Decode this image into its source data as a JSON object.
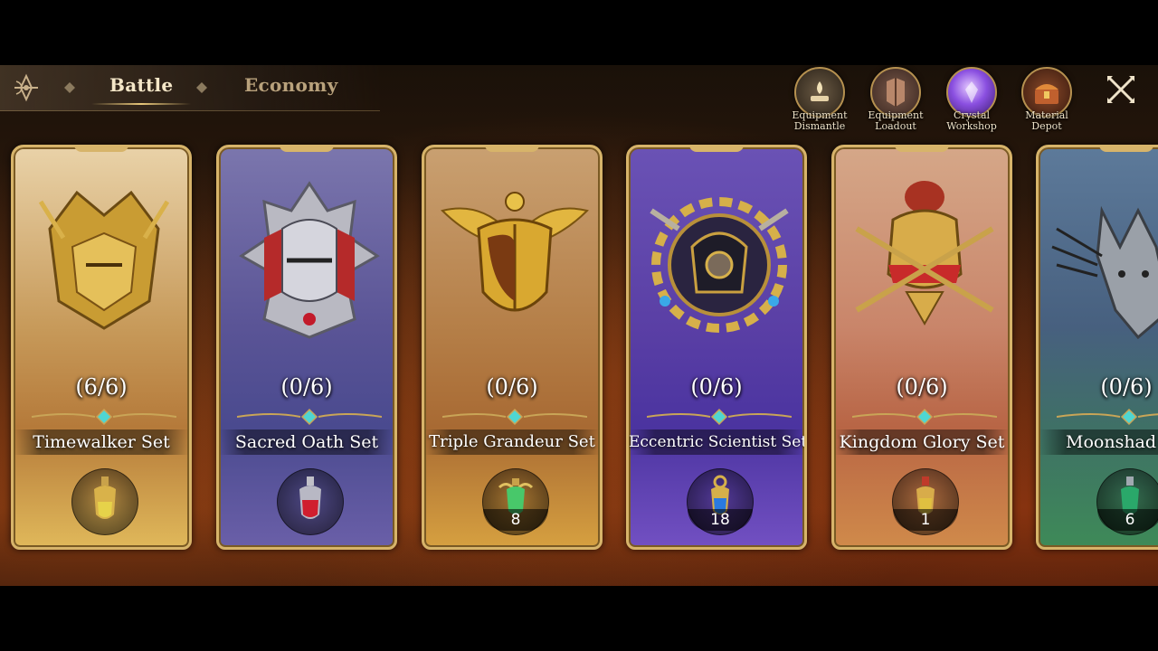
{
  "tabs": {
    "battle": "Battle",
    "economy": "Economy"
  },
  "shortcuts": [
    {
      "line1": "Equipment",
      "line2": "Dismantle",
      "icon": "anvil-flame-icon"
    },
    {
      "line1": "Equipment",
      "line2": "Loadout",
      "icon": "armor-icon"
    },
    {
      "line1": "Crystal",
      "line2": "Workshop",
      "icon": "crystal-orb-icon"
    },
    {
      "line1": "Material",
      "line2": "Depot",
      "icon": "treasure-chest-icon"
    }
  ],
  "close_icon": "crossed-swords-close-icon",
  "cards": [
    {
      "progress": "(6/6)",
      "name": "Timewalker Set",
      "potion_count": "",
      "theme": "#d7b46a"
    },
    {
      "progress": "(0/6)",
      "name": "Sacred Oath Set",
      "potion_count": "",
      "theme": "#5a5496"
    },
    {
      "progress": "(0/6)",
      "name": "Triple Grandeur Set",
      "potion_count": "8",
      "theme": "#b57f48"
    },
    {
      "progress": "(0/6)",
      "name": "Eccentric Scientist Set",
      "potion_count": "18",
      "theme": "#5a3fa5"
    },
    {
      "progress": "(0/6)",
      "name": "Kingdom Glory Set",
      "potion_count": "1",
      "theme": "#c9856a"
    },
    {
      "progress": "(0/6)",
      "name": "Moonshad",
      "potion_count": "6",
      "theme": "#3e8a58"
    }
  ]
}
